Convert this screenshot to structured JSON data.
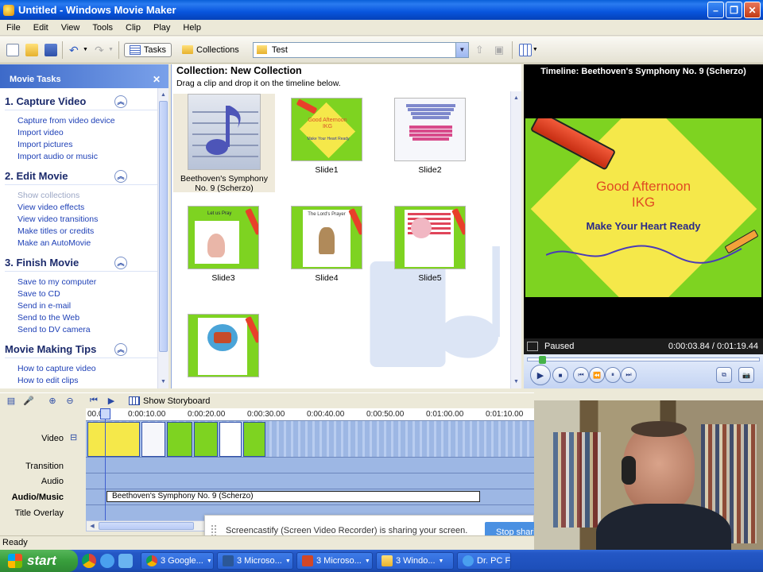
{
  "window": {
    "title": "Untitled - Windows Movie Maker"
  },
  "menu": [
    "File",
    "Edit",
    "View",
    "Tools",
    "Clip",
    "Play",
    "Help"
  ],
  "toolbar": {
    "tasks_label": "Tasks",
    "collections_label": "Collections",
    "collection_selected": "Test"
  },
  "tasks": {
    "header": "Movie Tasks",
    "sections": [
      {
        "title": "1. Capture Video",
        "links": [
          "Capture from video device",
          "Import video",
          "Import pictures",
          "Import audio or music"
        ]
      },
      {
        "title": "2. Edit Movie",
        "links": [
          "Show collections",
          "View video effects",
          "View video transitions",
          "Make titles or credits",
          "Make an AutoMovie"
        ]
      },
      {
        "title": "3. Finish Movie",
        "links": [
          "Save to my computer",
          "Save to CD",
          "Send in e-mail",
          "Send to the Web",
          "Send to DV camera"
        ]
      },
      {
        "title": "Movie Making Tips",
        "links": [
          "How to capture video",
          "How to edit clips"
        ]
      }
    ]
  },
  "collection": {
    "title": "Collection: New Collection",
    "subtitle": "Drag a clip and drop it on the timeline below.",
    "clips": [
      {
        "caption": "Beethoven's Symphony No. 9 (Scherzo)",
        "kind": "audio"
      },
      {
        "caption": "Slide1",
        "kind": "slide"
      },
      {
        "caption": "Slide2",
        "kind": "slide"
      },
      {
        "caption": "Slide3",
        "kind": "slide"
      },
      {
        "caption": "Slide4",
        "kind": "slide"
      },
      {
        "caption": "Slide5",
        "kind": "slide"
      },
      {
        "caption": "",
        "kind": "slide"
      }
    ],
    "slide_texts": {
      "slide1_line1": "Good Afternoon",
      "slide1_line2": "IKG",
      "slide1_line3": "Make Your Heart Ready",
      "slide3": "Let us Pray",
      "slide4": "The Lord's Prayer"
    }
  },
  "preview": {
    "title": "Timeline: Beethoven's Symphony No. 9 (Scherzo)",
    "frame_line1": "Good Afternoon",
    "frame_line2": "IKG",
    "frame_line3": "Make Your Heart Ready",
    "status": "Paused",
    "time": "0:00:03.84 / 0:01:19.44"
  },
  "timeline": {
    "show_storyboard": "Show Storyboard",
    "ticks": [
      "00.00",
      "0:00:10.00",
      "0:00:20.00",
      "0:00:30.00",
      "0:00:40.00",
      "0:00:50.00",
      "0:01:00.00",
      "0:01:10.00"
    ],
    "tracks": [
      "Video",
      "Transition",
      "Audio",
      "Audio/Music",
      "Title Overlay"
    ],
    "audio_clip": "Beethoven's Symphony No. 9 (Scherzo)",
    "expand_symbol": "⊟"
  },
  "screencastify": {
    "message": "Screencastify (Screen Video Recorder) is sharing your screen.",
    "stop_label": "Stop sharing"
  },
  "status": "Ready",
  "taskbar": {
    "start": "start",
    "items": [
      "3 Google...",
      "3 Microso...",
      "3 Microso...",
      "3 Windo...",
      "Dr. PC Fa..."
    ]
  },
  "colors": {
    "slide_green": "#7ed321",
    "slide_yellow": "#f5e84a",
    "xp_blue": "#0855dd"
  }
}
